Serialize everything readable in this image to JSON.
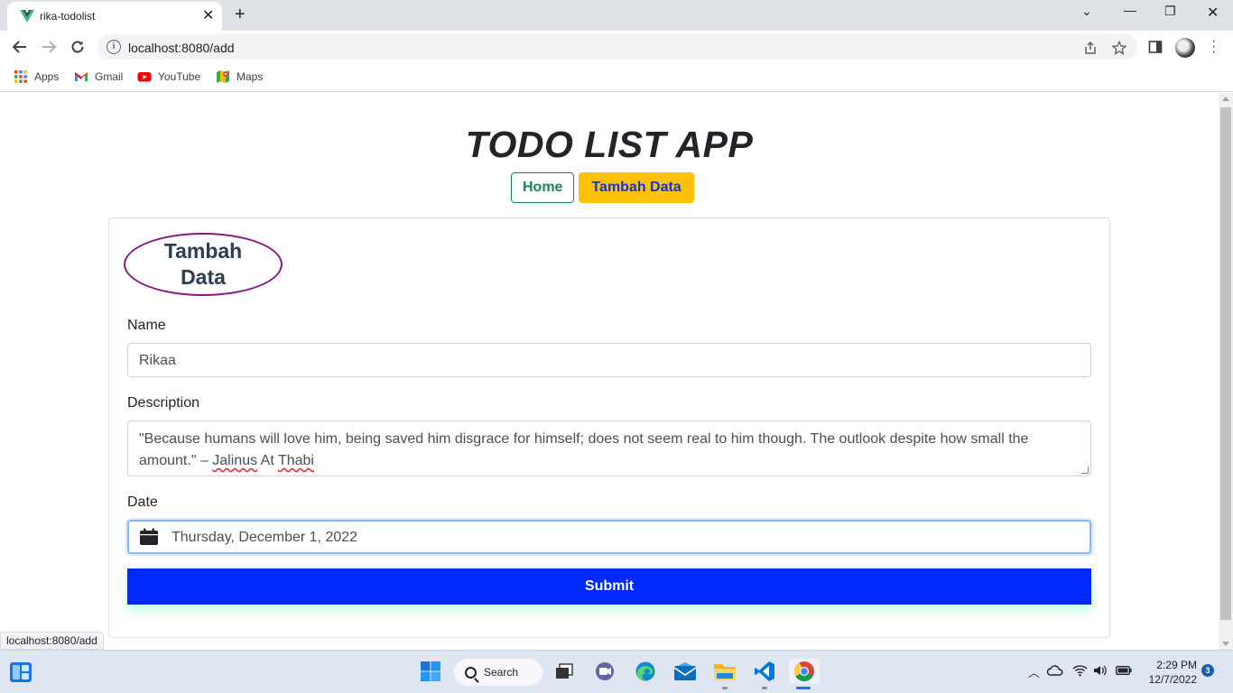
{
  "browser": {
    "tab_title": "rika-todolist",
    "url": "localhost:8080/add",
    "bookmarks": [
      {
        "label": "Apps",
        "icon": "apps-grid-icon"
      },
      {
        "label": "Gmail",
        "icon": "gmail-icon"
      },
      {
        "label": "YouTube",
        "icon": "youtube-icon"
      },
      {
        "label": "Maps",
        "icon": "maps-icon"
      }
    ],
    "status_url": "localhost:8080/add"
  },
  "page": {
    "app_title": "TODO LIST APP",
    "nav": {
      "home": "Home",
      "add": "Tambah Data"
    },
    "card_title_line1": "Tambah",
    "card_title_line2": "Data",
    "form": {
      "name_label": "Name",
      "name_value": "Rikaa",
      "description_label": "Description",
      "description_value_prefix": "\"Because humans will love him, being saved him disgrace for himself; does not seem real to him though. The outlook despite how small the amount.\" – ",
      "description_word1": "Jalinus",
      "description_word2": "At",
      "description_word3": "Thabi",
      "date_label": "Date",
      "date_value": "Thursday, December 1, 2022",
      "submit_label": "Submit"
    }
  },
  "taskbar": {
    "search_label": "Search",
    "time": "2:29 PM",
    "date": "12/7/2022",
    "notification_count": "3"
  },
  "colors": {
    "home_button": "#198754",
    "add_button_bg": "#ffc107",
    "add_button_text": "#0d35e0",
    "card_title_border": "#8a177d",
    "submit_bg": "#0029ff"
  }
}
